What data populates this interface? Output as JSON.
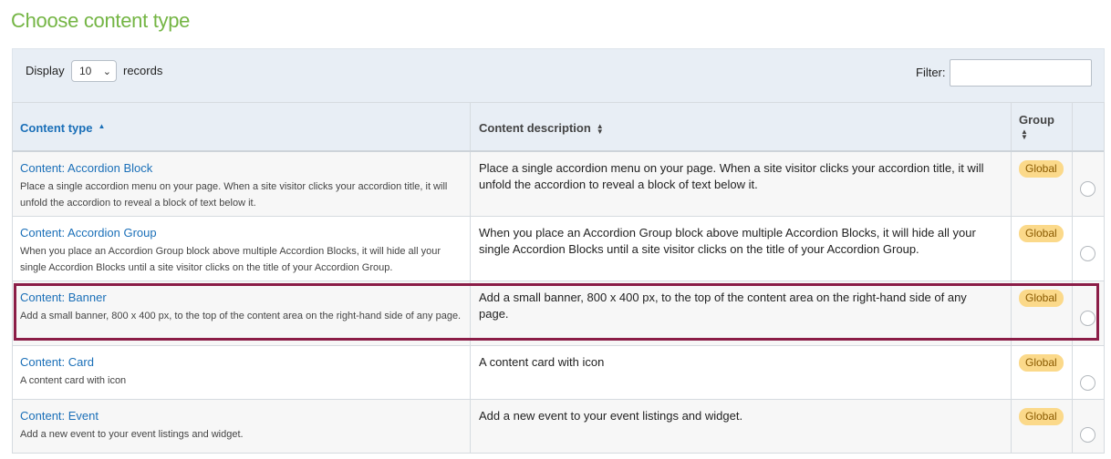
{
  "page": {
    "title": "Choose content type"
  },
  "toolbar": {
    "display_label": "Display",
    "display_value": "10",
    "records_label": "records",
    "filter_label": "Filter:",
    "filter_value": ""
  },
  "table": {
    "headers": {
      "content_type": "Content type",
      "content_description": "Content description",
      "group": "Group"
    },
    "sort": {
      "column": "content_type",
      "direction": "ascending"
    },
    "rows": [
      {
        "title": "Content: Accordion Block",
        "subtitle": "Place a single accordion menu on your page. When a site visitor clicks your accordion title, it will unfold the accordion to reveal a block of text below it.",
        "description": "Place a single accordion menu on your page. When a site visitor clicks your accordion title, it will unfold the accordion to reveal a block of text below it.",
        "group": "Global",
        "selected": false
      },
      {
        "title": "Content: Accordion Group",
        "subtitle": "When you place an Accordion Group block above multiple Accordion Blocks, it will hide all your single Accordion Blocks until a site visitor clicks on the title of your Accordion Group.",
        "description": "When you place an Accordion Group block above multiple Accordion Blocks, it will hide all your single Accordion Blocks until a site visitor clicks on the title of your Accordion Group.",
        "group": "Global",
        "selected": false
      },
      {
        "title": "Content: Banner",
        "subtitle": "Add a small banner, 800 x 400 px, to the top of the content area on the right-hand side of any page.",
        "description": "Add a small banner, 800 x 400 px, to the top of the content area on the right-hand side of any page.",
        "group": "Global",
        "selected": false,
        "highlighted": true
      },
      {
        "title": "Content: Card",
        "subtitle": "A content card with icon",
        "description": "A content card with icon",
        "group": "Global",
        "selected": false
      },
      {
        "title": "Content: Event",
        "subtitle": "Add a new event to your event listings and widget.",
        "description": "Add a new event to your event listings and widget.",
        "group": "Global",
        "selected": false
      }
    ]
  },
  "colors": {
    "title_green": "#74b544",
    "link_blue": "#1a6fb8",
    "badge_bg": "#fbd98a",
    "highlight": "#8b1d47"
  }
}
